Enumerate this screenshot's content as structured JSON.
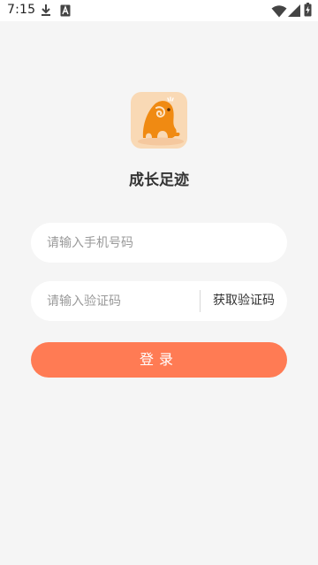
{
  "status_bar": {
    "time": "7:15",
    "left_icons": [
      "download-icon",
      "a-box-icon"
    ],
    "right_icons": [
      "wifi-icon",
      "signal-icon",
      "battery-charging-icon"
    ]
  },
  "app": {
    "logo_icon": "elephant-logo-icon",
    "name": "成长足迹"
  },
  "phone_field": {
    "placeholder": "请输入手机号码",
    "value": ""
  },
  "code_field": {
    "placeholder": "请输入验证码",
    "value": "",
    "get_code_label": "获取验证码"
  },
  "login_button": {
    "label": "登录"
  },
  "colors": {
    "accent": "#ff7b54",
    "background": "#f5f5f5",
    "logo_bg": "#f9d9b5",
    "logo_fg": "#f08a12"
  }
}
